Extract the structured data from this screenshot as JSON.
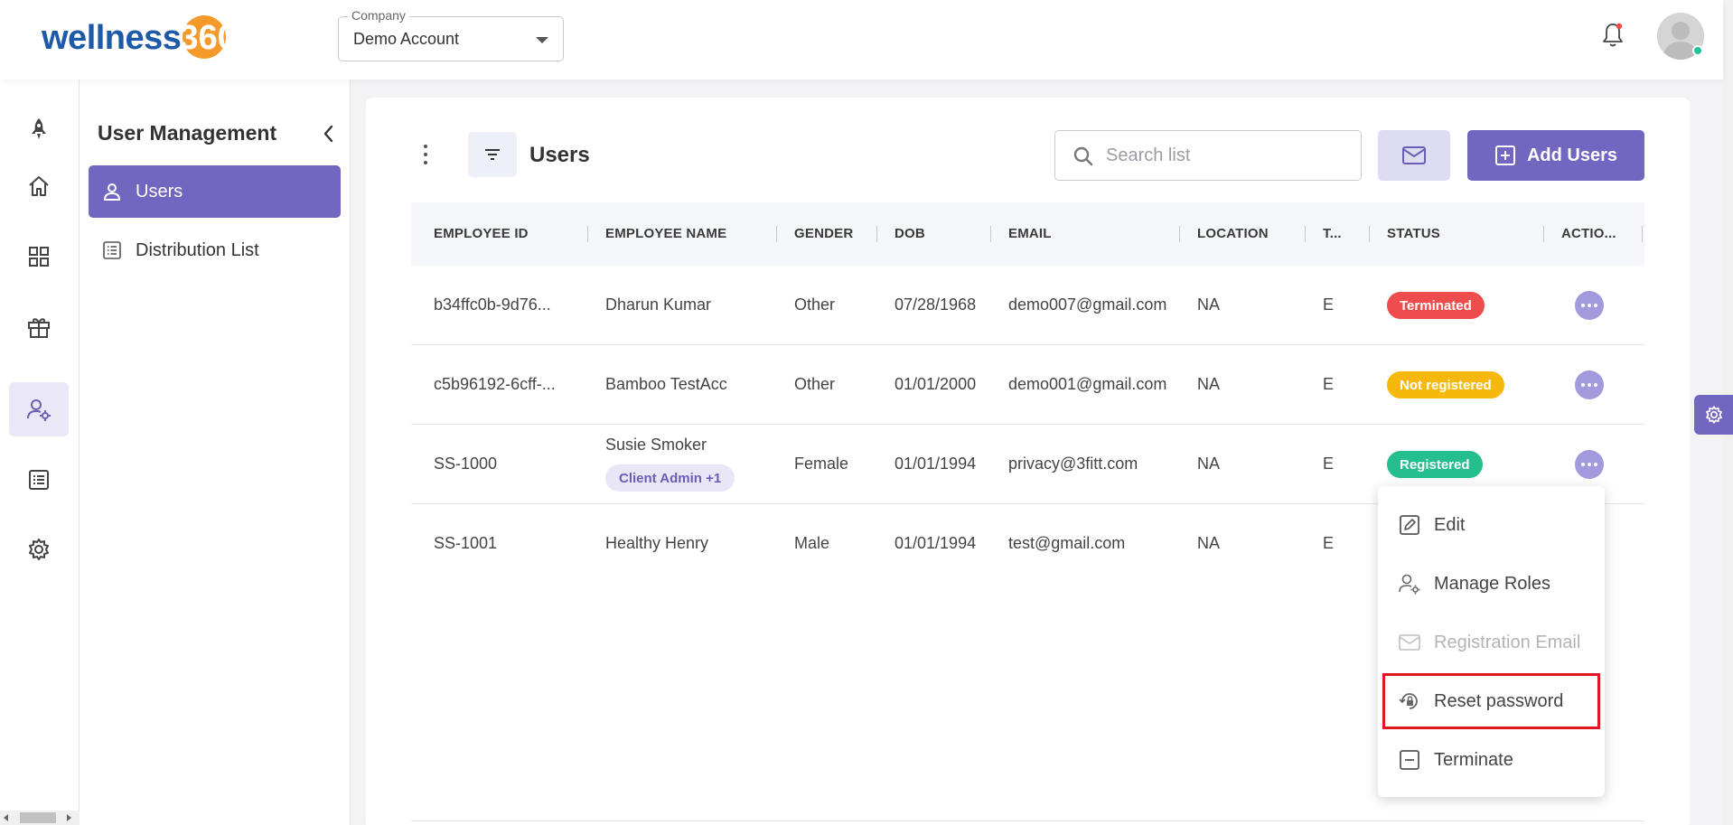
{
  "brand": {
    "logo_text": "wellness",
    "logo_number": "360"
  },
  "company": {
    "label": "Company",
    "value": "Demo Account"
  },
  "rail": [
    "rocket-icon",
    "home-icon",
    "dashboard-icon",
    "gift-icon",
    "user-settings-icon",
    "list-icon",
    "gear-icon"
  ],
  "subnav": {
    "title": "User Management",
    "items": [
      {
        "label": "Users",
        "icon": "user-icon",
        "active": true
      },
      {
        "label": "Distribution List",
        "icon": "list-icon",
        "active": false
      }
    ]
  },
  "toolbar": {
    "title": "Users",
    "search_placeholder": "Search list",
    "add_label": "Add Users"
  },
  "table": {
    "columns": [
      "EMPLOYEE ID",
      "EMPLOYEE NAME",
      "GENDER",
      "DOB",
      "EMAIL",
      "LOCATION",
      "T...",
      "STATUS",
      "ACTIO..."
    ],
    "rows": [
      {
        "id": "b34ffc0b-9d76...",
        "name": "Dharun Kumar",
        "gender": "Other",
        "dob": "07/28/1968",
        "email": "demo007@gmail.com",
        "location": "NA",
        "type": "E",
        "status": "Terminated"
      },
      {
        "id": "c5b96192-6cff-...",
        "name": "Bamboo TestAcc",
        "gender": "Other",
        "dob": "01/01/2000",
        "email": "demo001@gmail.com",
        "location": "NA",
        "type": "E",
        "status": "Not registered"
      },
      {
        "id": "SS-1000",
        "name": "Susie Smoker",
        "role": "Client Admin +1",
        "gender": "Female",
        "dob": "01/01/1994",
        "email": "privacy@3fitt.com",
        "location": "NA",
        "type": "E",
        "status": "Registered"
      },
      {
        "id": "SS-1001",
        "name": "Healthy Henry",
        "gender": "Male",
        "dob": "01/01/1994",
        "email": "test@gmail.com",
        "location": "NA",
        "type": "E",
        "status": ""
      }
    ]
  },
  "status_colors": {
    "Terminated": "#ef4d4d",
    "Not registered": "#f6b90b",
    "Registered": "#25bf8e"
  },
  "action_menu": [
    {
      "label": "Edit",
      "icon": "edit-icon",
      "enabled": true
    },
    {
      "label": "Manage Roles",
      "icon": "user-settings-icon",
      "enabled": true
    },
    {
      "label": "Registration Email",
      "icon": "mail-icon",
      "enabled": false
    },
    {
      "label": "Reset password",
      "icon": "lock-reset-icon",
      "enabled": true,
      "highlighted": true
    },
    {
      "label": "Terminate",
      "icon": "minus-box-icon",
      "enabled": true
    }
  ],
  "colors": {
    "accent": "#7166c0",
    "accent_light": "#dedcf3",
    "highlight_border": "#e1151f"
  }
}
